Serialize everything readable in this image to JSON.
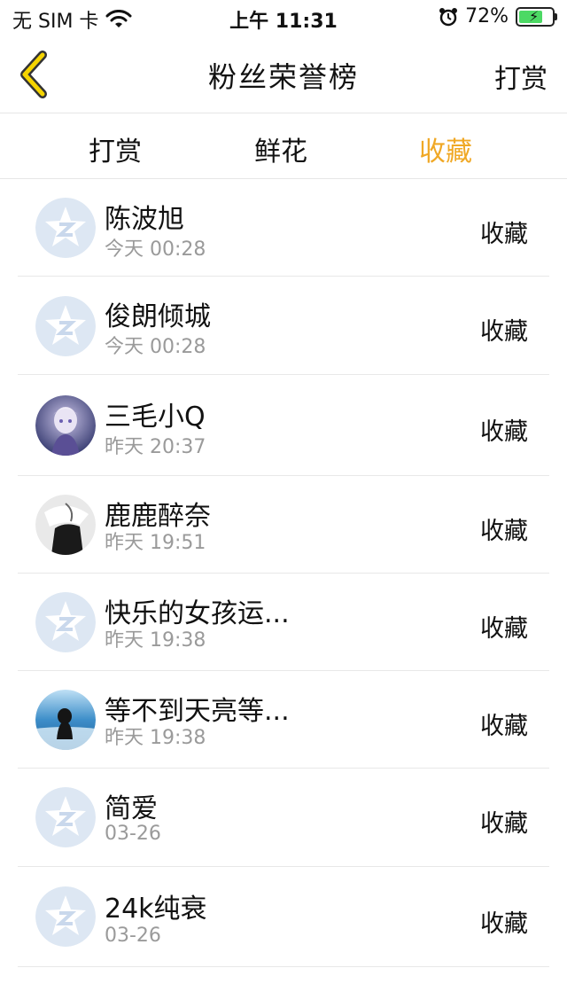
{
  "status_bar": {
    "carrier": "无 SIM 卡",
    "time": "上午 11:31",
    "battery": "72%",
    "battery_level": 0.72,
    "icons": [
      "wifi-icon",
      "alarm-icon",
      "battery-charging-icon"
    ]
  },
  "nav": {
    "back_icon": "chevron-left-icon",
    "title": "粉丝荣誉榜",
    "right_label": "打赏"
  },
  "tabs": [
    {
      "label": "打赏",
      "active": false
    },
    {
      "label": "鲜花",
      "active": false
    },
    {
      "label": "收藏",
      "active": true
    }
  ],
  "colors": {
    "accent": "#f0a825",
    "back_icon": "#f5d400",
    "default_avatar": "#dde7f3"
  },
  "fans": [
    {
      "name": "陈波旭",
      "time": "今天 00:28",
      "action": "收藏",
      "avatar": "default-avatar-icon"
    },
    {
      "name": "俊朗倾城",
      "time": "今天 00:28",
      "action": "收藏",
      "avatar": "default-avatar-icon"
    },
    {
      "name": "三毛小Q",
      "time": "昨天 20:37",
      "action": "收藏",
      "avatar": "anime-character-avatar"
    },
    {
      "name": "鹿鹿醉奈",
      "time": "昨天 19:51",
      "action": "收藏",
      "avatar": "photo-avatar"
    },
    {
      "name": "快乐的女孩运...",
      "time": "昨天 19:38",
      "action": "收藏",
      "avatar": "default-avatar-icon"
    },
    {
      "name": "等不到天亮等...",
      "time": "昨天 19:38",
      "action": "收藏",
      "avatar": "sea-photo-avatar"
    },
    {
      "name": "简爱",
      "time": "03-26",
      "action": "收藏",
      "avatar": "default-avatar-icon"
    },
    {
      "name": "24k纯衰",
      "time": "03-26",
      "action": "收藏",
      "avatar": "default-avatar-icon"
    }
  ]
}
